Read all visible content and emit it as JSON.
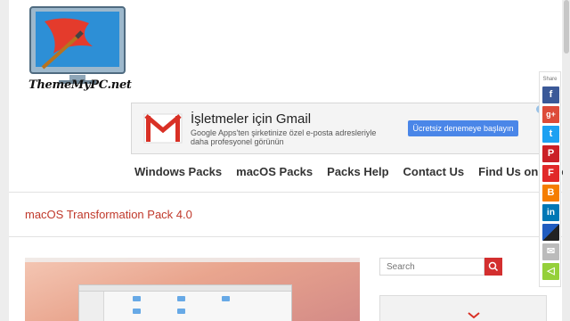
{
  "site": {
    "logo_text": "ThemeMyPC.net"
  },
  "ad": {
    "title": "İşletmeler için Gmail",
    "description": "Google Apps'ten şirketinize özel e-posta adresleriyle daha profesyonel görünün",
    "cta": "Ücretsiz denemeye başlayın",
    "info": "i",
    "brand_color": "#d93025"
  },
  "nav": {
    "items": [
      {
        "label": "Windows Packs"
      },
      {
        "label": "macOS Packs"
      },
      {
        "label": "Packs Help"
      },
      {
        "label": "Contact Us"
      },
      {
        "label": "Find Us on Facebook"
      }
    ]
  },
  "page": {
    "title": "macOS Transformation Pack 4.0"
  },
  "search": {
    "placeholder": "Search"
  },
  "share": {
    "label": "Share",
    "buttons": [
      {
        "name": "facebook",
        "glyph": "f",
        "color": "#3b5998"
      },
      {
        "name": "google-plus",
        "glyph": "g+",
        "color": "#dd4b39"
      },
      {
        "name": "twitter",
        "glyph": "t",
        "color": "#1da1f2"
      },
      {
        "name": "pinterest",
        "glyph": "P",
        "color": "#cb2027"
      },
      {
        "name": "flipboard",
        "glyph": "F",
        "color": "#e12828"
      },
      {
        "name": "blogger",
        "glyph": "B",
        "color": "#f57d00"
      },
      {
        "name": "linkedin",
        "glyph": "in",
        "color": "#0077b5"
      },
      {
        "name": "delicious",
        "glyph": "",
        "color": "#205cc0"
      },
      {
        "name": "email",
        "glyph": "✉",
        "color": "#bbbbbb"
      },
      {
        "name": "sharethis",
        "glyph": "◁",
        "color": "#95d03a"
      }
    ]
  },
  "colors": {
    "accent": "#c0392b",
    "search_button": "#d32f2f"
  }
}
